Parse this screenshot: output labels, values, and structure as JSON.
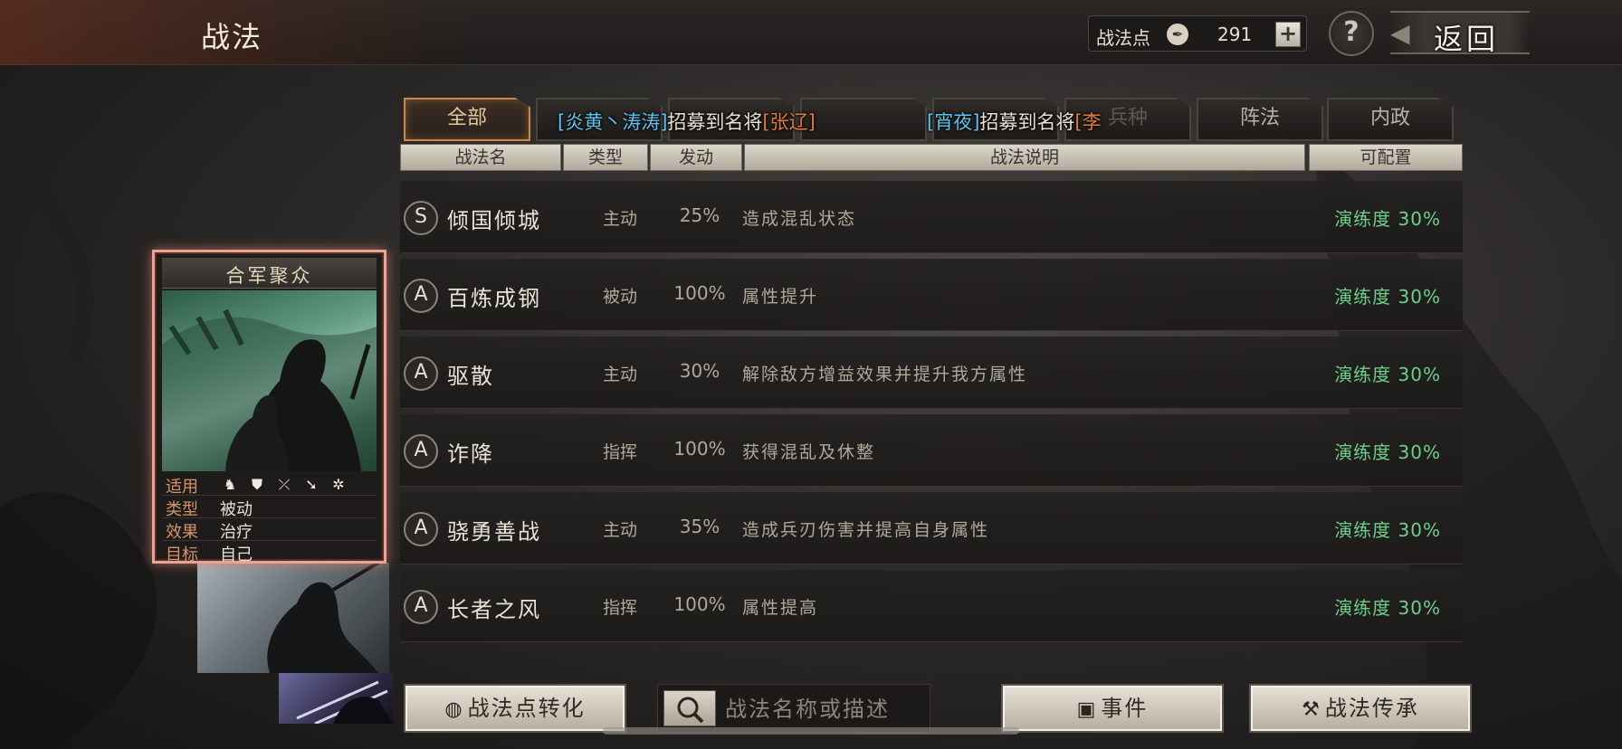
{
  "header": {
    "title": "战法",
    "points_label": "战法点",
    "points_value": "291",
    "add_symbol": "+",
    "help_symbol": "?",
    "back_label": "返回"
  },
  "tabs": [
    {
      "label": "全部",
      "active": true
    },
    {
      "label": "",
      "active": false
    },
    {
      "label": "",
      "active": false
    },
    {
      "label": "",
      "active": false
    },
    {
      "label": "",
      "active": false
    },
    {
      "label": "兵种",
      "active": false
    },
    {
      "label": "阵法",
      "active": false
    },
    {
      "label": "内政",
      "active": false
    }
  ],
  "notices": [
    {
      "prefix": "[炎黄丶涛涛]",
      "middle": "招募到名将",
      "suffix": "[张辽]"
    },
    {
      "prefix": "[宵夜]",
      "middle": "招募到名将",
      "suffix": "[李"
    }
  ],
  "columns": {
    "name": "战法名",
    "type": "类型",
    "chance": "发动",
    "desc": "战法说明",
    "config": "可配置"
  },
  "rows": [
    {
      "grade": "S",
      "name": "倾国倾城",
      "type": "主动",
      "chance": "25%",
      "desc": "造成混乱状态",
      "train": "演练度 30%"
    },
    {
      "grade": "A",
      "name": "百炼成钢",
      "type": "被动",
      "chance": "100%",
      "desc": "属性提升",
      "train": "演练度 30%"
    },
    {
      "grade": "A",
      "name": "驱散",
      "type": "主动",
      "chance": "30%",
      "desc": "解除敌方增益效果并提升我方属性",
      "train": "演练度 30%"
    },
    {
      "grade": "A",
      "name": "诈降",
      "type": "指挥",
      "chance": "100%",
      "desc": "获得混乱及休整",
      "train": "演练度 30%"
    },
    {
      "grade": "A",
      "name": "骁勇善战",
      "type": "主动",
      "chance": "35%",
      "desc": "造成兵刃伤害并提高自身属性",
      "train": "演练度 30%"
    },
    {
      "grade": "A",
      "name": "长者之风",
      "type": "指挥",
      "chance": "100%",
      "desc": "属性提高",
      "train": "演练度 30%"
    }
  ],
  "card": {
    "title": "合军聚众",
    "rows": [
      {
        "key": "适用",
        "value": ""
      },
      {
        "key": "类型",
        "value": "被动"
      },
      {
        "key": "效果",
        "value": "治疗"
      },
      {
        "key": "目标",
        "value": "自己"
      }
    ],
    "unit_icons": [
      "cavalry-icon",
      "shield-icon",
      "bow-icon",
      "spear-icon",
      "wheel-icon"
    ]
  },
  "bottom": {
    "convert_label": "战法点转化",
    "search_placeholder": "战法名称或描述",
    "event_label": "事件",
    "inherit_label": "战法传承"
  },
  "colors": {
    "train_green": "#6ccf8a",
    "notice_blue": "#5ec3f0",
    "notice_orange": "#e07a3c",
    "card_border": "#e8a596",
    "tab_active_border": "#c98a48"
  }
}
